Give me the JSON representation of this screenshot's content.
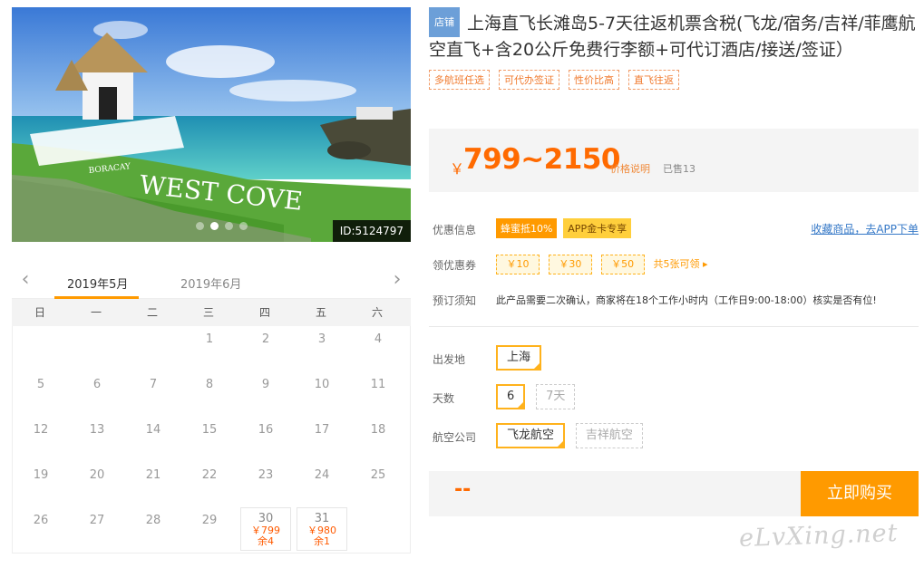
{
  "photo": {
    "alt": "Boracay West Cove",
    "id_label": "ID:5124797",
    "scene_text_1": "BORACAY",
    "scene_text_2": "WEST COVE",
    "slide_count": 4,
    "active_slide": 2
  },
  "calendar": {
    "tabs": [
      "2019年5月",
      "2019年6月"
    ],
    "active_tab": 0,
    "weekdays": [
      "日",
      "一",
      "二",
      "三",
      "四",
      "五",
      "六"
    ],
    "days": [
      {
        "d": ""
      },
      {
        "d": ""
      },
      {
        "d": ""
      },
      {
        "d": "1"
      },
      {
        "d": "2"
      },
      {
        "d": "3"
      },
      {
        "d": "4"
      },
      {
        "d": "5"
      },
      {
        "d": "6"
      },
      {
        "d": "7"
      },
      {
        "d": "8"
      },
      {
        "d": "9"
      },
      {
        "d": "10"
      },
      {
        "d": "11"
      },
      {
        "d": "12"
      },
      {
        "d": "13"
      },
      {
        "d": "14"
      },
      {
        "d": "15"
      },
      {
        "d": "16"
      },
      {
        "d": "17"
      },
      {
        "d": "18"
      },
      {
        "d": "19"
      },
      {
        "d": "20"
      },
      {
        "d": "21"
      },
      {
        "d": "22"
      },
      {
        "d": "23"
      },
      {
        "d": "24"
      },
      {
        "d": "25"
      },
      {
        "d": "26"
      },
      {
        "d": "27"
      },
      {
        "d": "28"
      },
      {
        "d": "29"
      },
      {
        "d": "30",
        "price": "￥799",
        "left": "余4"
      },
      {
        "d": "31",
        "price": "￥980",
        "left": "余1"
      },
      {
        "d": ""
      }
    ]
  },
  "product": {
    "shop_badge": "店铺",
    "title": "上海直飞长滩岛5-7天往返机票含税(飞龙/宿务/吉祥/菲鹰航空直飞+含20公斤免费行李额+可代订酒店/接送/签证）",
    "tags": [
      "多航班任选",
      "可代办签证",
      "性价比高",
      "直飞往返"
    ],
    "price_symbol": "￥",
    "price_range": "799~2150",
    "price_explain": "价格说明",
    "sold": "已售13"
  },
  "info": {
    "promo_label": "优惠信息",
    "promo_badges": [
      "蜂蜜抵10%",
      "APP金卡专享"
    ],
    "fav_link": "收藏商品，去APP下单",
    "coupon_label": "领优惠券",
    "coupons": [
      "￥10",
      "￥30",
      "￥50"
    ],
    "coupon_more": "共5张可领 ▸",
    "notice_label": "预订须知",
    "notice_text": "此产品需要二次确认，商家将在18个工作小时内（工作日9:00-18:00）核实是否有位!"
  },
  "options": {
    "departure_label": "出发地",
    "departure": [
      "上海"
    ],
    "days_label": "天数",
    "days": [
      "6",
      "7天"
    ],
    "airline_label": "航空公司",
    "airlines": [
      "飞龙航空",
      "吉祥航空"
    ]
  },
  "buy": {
    "total": "--",
    "button": "立即购买"
  },
  "watermark": "eLvXing.net",
  "colors": {
    "accent": "#ff9a00",
    "price": "#ff6a00",
    "link": "#3578c7"
  }
}
